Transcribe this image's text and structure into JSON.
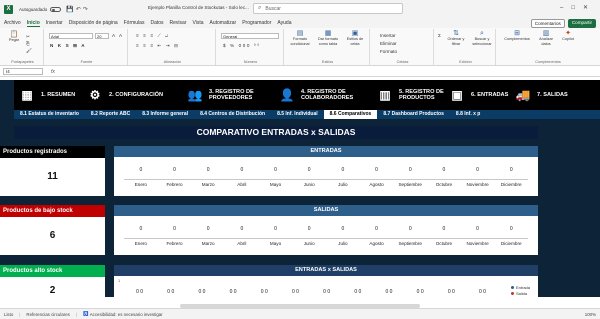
{
  "titlebar": {
    "app_icon": "X",
    "autosave_label": "Autoguardado",
    "doc_title": "Ejemplo Planilla Control de Stockutas - Solo lec...",
    "search_placeholder": "Buscar"
  },
  "menu": {
    "items": [
      "Archivo",
      "Inicio",
      "Insertar",
      "Disposición de página",
      "Fórmulas",
      "Datos",
      "Revisar",
      "Vista",
      "Automatizar",
      "Programador",
      "Ayuda"
    ],
    "active": "Inicio",
    "comments_label": "Comentarios",
    "share_label": "Compartir"
  },
  "ribbon": {
    "paste_label": "Pegar",
    "clipboard_group": "Portapapeles",
    "font_name": "Arial",
    "font_size": "20",
    "font_group": "Fuente",
    "alignment_group": "Alineación",
    "number_format": "General",
    "number_group": "Número",
    "cond_format_label": "Formato condicional",
    "table_format_label": "Dar formato como tabla",
    "cell_styles_label": "Estilos de celda",
    "styles_group": "Estilos",
    "insert_label": "Insertar",
    "delete_label": "Eliminar",
    "format_label": "Formato",
    "cells_group": "Celdas",
    "sort_label": "Ordenar y filtrar",
    "find_label": "Buscar y seleccionar",
    "editing_group": "Edición",
    "addins_label": "Complementos",
    "addins_group": "Complementos",
    "analyze_label": "Analizar datos",
    "copilot_label": "Copilot"
  },
  "formula_bar": {
    "cell_ref": "I4",
    "fx": "fx"
  },
  "nav": {
    "buttons": [
      {
        "label1": "1. RESUMEN",
        "label2": ""
      },
      {
        "label1": "2. CONFIGURACIÓN",
        "label2": ""
      },
      {
        "label1": "3. REGISTRO DE",
        "label2": "PROVEEDORES"
      },
      {
        "label1": "4. REGISTRO DE",
        "label2": "COLABORADORES"
      },
      {
        "label1": "5. REGISTRO DE",
        "label2": "PRODUCTOS"
      },
      {
        "label1": "6. ENTRADAS",
        "label2": ""
      },
      {
        "label1": "7. SALIDAS",
        "label2": ""
      }
    ],
    "subtabs": [
      "8.1 Estatus de inventario",
      "8.2 Reporte ABC",
      "8.3 Informe general",
      "8.4 Centros de Distribución",
      "8.5 Inf. Individual",
      "8.6 Comparativos",
      "8.7 Dashboard Productos",
      "8.8 Inf. x p"
    ],
    "active_subtab": "8.6 Comparativos"
  },
  "dashboard": {
    "title": "COMPARATIVO ENTRADAS x SALIDAS",
    "cards": [
      {
        "label": "Productos registrados",
        "value": "11",
        "color": "#000000"
      },
      {
        "label": "Productos de bajo stock",
        "value": "6",
        "color": "#c00000"
      },
      {
        "label": "Productos alto stock",
        "value": "2",
        "color": "#00b050"
      }
    ],
    "panels": {
      "entradas_title": "ENTRADAS",
      "salidas_title": "SALIDAS",
      "combined_title": "ENTRADAS x SALIDAS",
      "months": [
        "Enero",
        "Febrero",
        "Marzo",
        "Abril",
        "Mayo",
        "Junio",
        "Julio",
        "Agosto",
        "Septiembre",
        "Octubre",
        "Noviembre",
        "Diciembre"
      ],
      "zero": "0",
      "ytick_1": "1",
      "legend_in": "Entrada",
      "legend_out": "Salida"
    }
  },
  "statusbar": {
    "ready": "Listo",
    "circular": "Referencias circulares",
    "accessibility": "Accesibilidad: es necesario investigar",
    "zoom": "100%"
  }
}
